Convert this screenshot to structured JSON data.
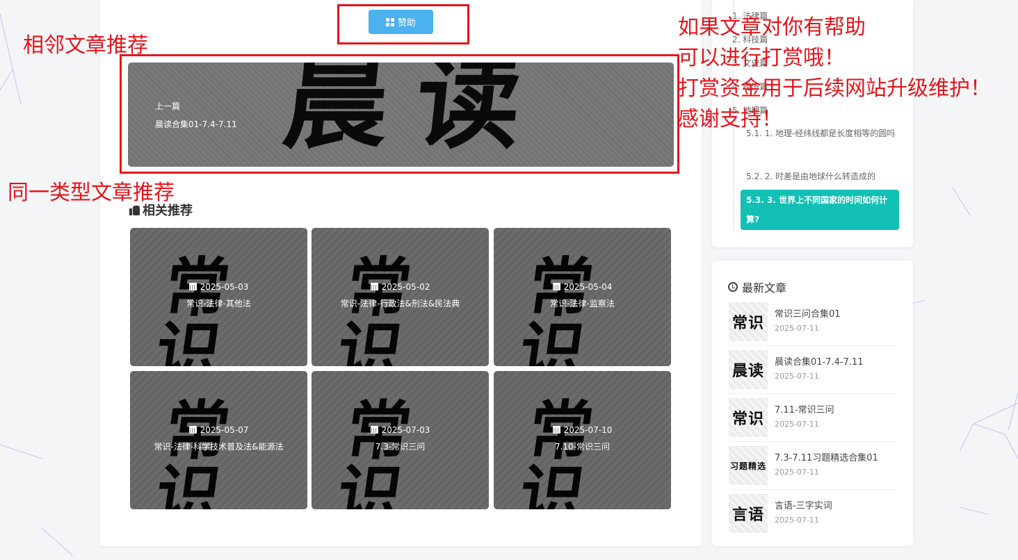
{
  "main": {
    "sponsor_label": "赞助",
    "prev": {
      "label": "上一篇",
      "title": "晨读合集01-7.4-7.11",
      "calligraphy": "晨读"
    },
    "related": {
      "heading": "相关推荐",
      "cards": [
        {
          "date": "2025-05-03",
          "title": "常识-法律-其他法",
          "calligraphy": "常识"
        },
        {
          "date": "2025-05-02",
          "title": "常识-法律-行政法&刑法&民法典",
          "calligraphy": "常识"
        },
        {
          "date": "2025-05-04",
          "title": "常识-法律-监察法",
          "calligraphy": "常识"
        },
        {
          "date": "2025-05-07",
          "title": "常识-法律-科学技术普及法&能源法",
          "calligraphy": "常识"
        },
        {
          "date": "2025-07-03",
          "title": "7.3-常识三问",
          "calligraphy": "常识"
        },
        {
          "date": "2025-07-10",
          "title": "7.10-常识三问",
          "calligraphy": "常识"
        }
      ]
    }
  },
  "annotations": {
    "adjacent": "相邻文章推荐",
    "same_type": "同一类型文章推荐",
    "donate_lines": [
      "如果文章对你有帮助",
      "可以进行打赏哦！",
      "打赏资金用于后续网站升级维护！",
      "感谢支持！"
    ]
  },
  "toc": {
    "items": [
      "1. 法律篇",
      "2. 科技篇",
      "3. 文史篇",
      "4. 经济篇",
      "5. 地理篇"
    ],
    "subitems": [
      "5.1. 1. 地理-经纬线都是长度相等的圆吗",
      "5.2. 2. 时差是由地球什么转造成的"
    ],
    "active": "5.3. 3. 世界上不同国家的时间如何计算?"
  },
  "latest": {
    "heading": "最新文章",
    "items": [
      {
        "title": "常识三问合集01",
        "date": "2025-07-11",
        "thumb": "常识"
      },
      {
        "title": "晨读合集01-7.4-7.11",
        "date": "2025-07-11",
        "thumb": "晨读"
      },
      {
        "title": "7.11-常识三问",
        "date": "2025-07-11",
        "thumb": "常识"
      },
      {
        "title": "7.3-7.11习题精选合集01",
        "date": "2025-07-11",
        "thumb": "习题精选"
      },
      {
        "title": "言语-三字实词",
        "date": "2025-07-11",
        "thumb": "言语"
      }
    ]
  },
  "colors": {
    "accent": "#4bb1ef",
    "toc_active": "#12c0b4",
    "annotation": "#e4151b"
  }
}
